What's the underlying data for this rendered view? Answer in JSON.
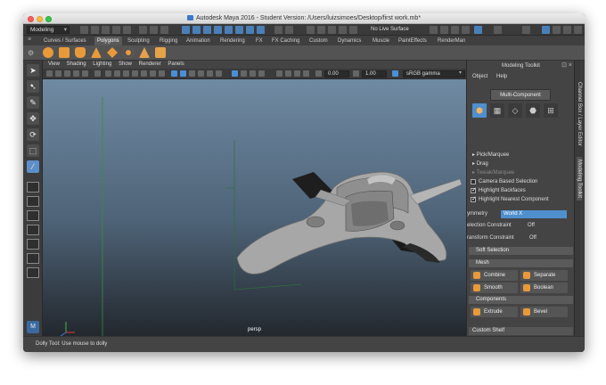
{
  "window": {
    "title": "Autodesk Maya 2016 - Student Version: /Users/luizsimoes/Desktop/first work.mb*"
  },
  "status_line": {
    "mode": "Modeling",
    "live_surface": "No Live Surface"
  },
  "shelf_tabs": [
    {
      "label": "Curves / Surfaces",
      "active": false
    },
    {
      "label": "Polygons",
      "active": true
    },
    {
      "label": "Sculpting",
      "active": false
    },
    {
      "label": "Rigging",
      "active": false
    },
    {
      "label": "Animation",
      "active": false
    },
    {
      "label": "Rendering",
      "active": false
    },
    {
      "label": "FX",
      "active": false
    },
    {
      "label": "FX Caching",
      "active": false
    },
    {
      "label": "Custom",
      "active": false
    },
    {
      "label": "Dynamics",
      "active": false
    },
    {
      "label": "Muscle",
      "active": false
    },
    {
      "label": "PaintEffects",
      "active": false
    },
    {
      "label": "RenderMan",
      "active": false
    }
  ],
  "panel_menu": [
    "View",
    "Shading",
    "Lighting",
    "Show",
    "Renderer",
    "Panels"
  ],
  "panel_toolbar": {
    "value_a": "0.00",
    "value_b": "1.00",
    "color_space": "sRGB gamma"
  },
  "viewport": {
    "camera_label": "persp"
  },
  "help_line": "Dolly Tool: Use mouse to dolly",
  "modeling_toolkit": {
    "title": "Modeling Toolkit",
    "menu": [
      "Object",
      "Help"
    ],
    "selection_mode": "Multi-Component",
    "pick_marquee": "Pick/Marquee",
    "drag": "Drag",
    "tweak_marquee": "Tweak/Marquee",
    "options": [
      {
        "label": "Camera Based Selection",
        "checked": false
      },
      {
        "label": "Highlight Backfaces",
        "checked": true
      },
      {
        "label": "Highlight Nearest Component",
        "checked": true
      }
    ],
    "symmetry_label": "ymmetry",
    "symmetry_value": "World X",
    "selection_constraint_label": "election Constraint",
    "selection_constraint_value": "Off",
    "transform_constraint_label": "ransform Constraint",
    "transform_constraint_value": "Off",
    "soft_selection": "Soft Selection",
    "mesh_section": "Mesh",
    "mesh_tools": [
      "Combine",
      "Separate",
      "Smooth",
      "Boolean"
    ],
    "components_section": "Components",
    "component_tools": [
      "Extrude",
      "Bevel"
    ],
    "custom_shelf": "Custom Shelf"
  },
  "side_tabs": [
    "Channel Box / Layer Editor",
    "Modeling Toolkit"
  ]
}
